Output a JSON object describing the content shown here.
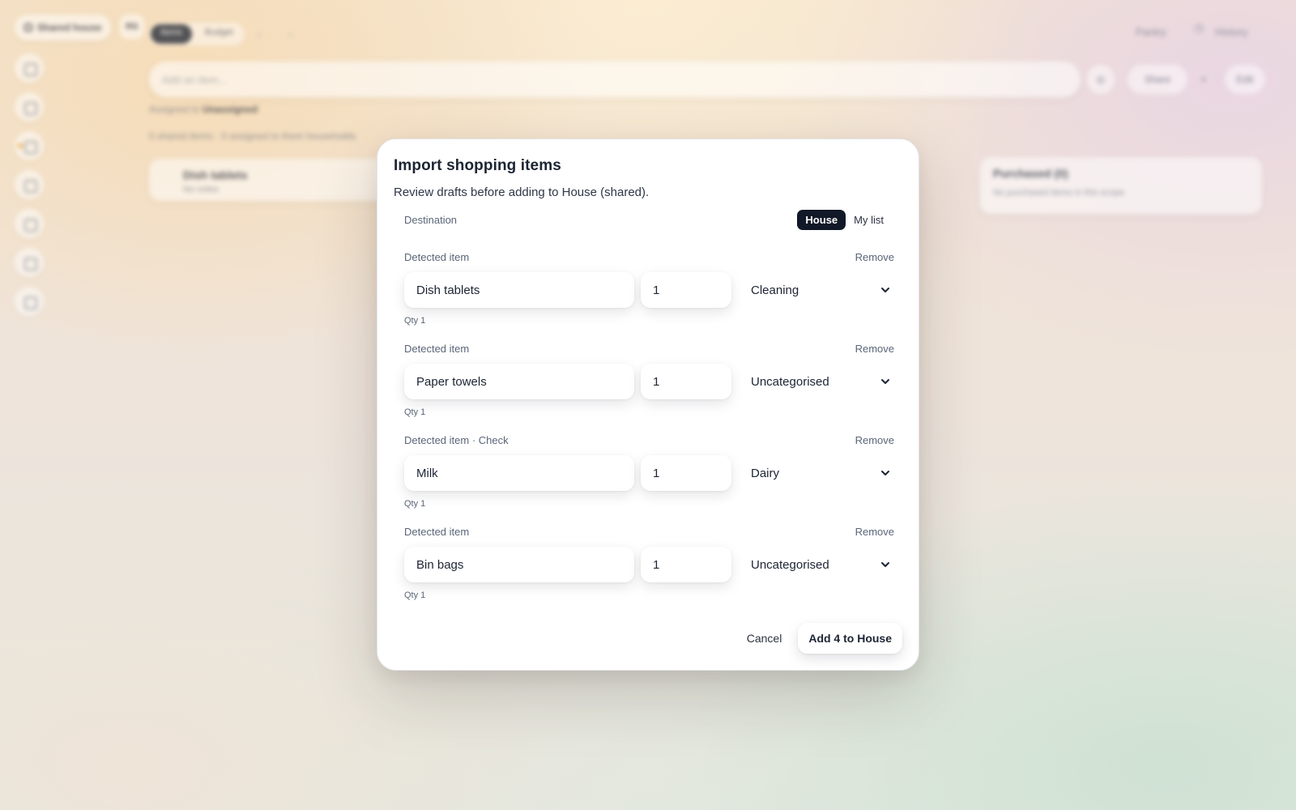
{
  "background": {
    "house_chip": "Shared house",
    "small_chip": "RS",
    "tabs": [
      "Items",
      "Budget"
    ],
    "top_right": [
      "Pantry",
      "History"
    ],
    "search_placeholder": "Add an item...",
    "share_label": "Share",
    "edit_label": "Edit",
    "assigned_label": "Assigned to",
    "assigned_value": "Unassigned",
    "meta_line": "0 shared items · 0 assigned to them households",
    "card_left_title": "Dish tablets",
    "card_left_sub": "No notes",
    "card_right_title": "Purchased (0)",
    "card_right_sub": "No purchased items in this scope"
  },
  "modal": {
    "title": "Import shopping items",
    "subtitle": "Review drafts before adding to House (shared).",
    "destination_label": "Destination",
    "destination_options": [
      "House",
      "My list"
    ],
    "destination_selected": "House",
    "items": [
      {
        "label": "Detected item",
        "remove": "Remove",
        "name": "Dish tablets",
        "qty": "1",
        "category": "Cleaning",
        "note": "Qty 1"
      },
      {
        "label": "Detected item",
        "remove": "Remove",
        "name": "Paper towels",
        "qty": "1",
        "category": "Uncategorised",
        "note": "Qty 1"
      },
      {
        "label": "Detected item · Check",
        "remove": "Remove",
        "name": "Milk",
        "qty": "1",
        "category": "Dairy",
        "note": "Qty 1"
      },
      {
        "label": "Detected item",
        "remove": "Remove",
        "name": "Bin bags",
        "qty": "1",
        "category": "Uncategorised",
        "note": "Qty 1"
      }
    ],
    "cancel_label": "Cancel",
    "submit_label": "Add 4 to House"
  },
  "colors": {
    "accent_dark": "#111827",
    "text": "#1c2433",
    "muted": "#5a6578"
  }
}
